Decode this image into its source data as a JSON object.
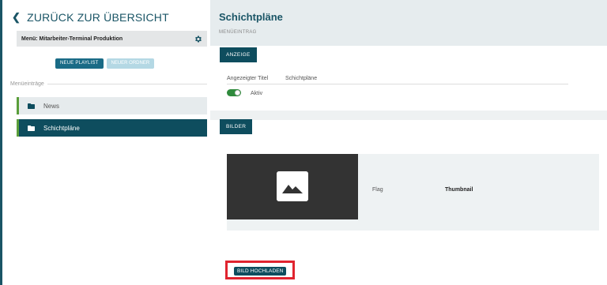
{
  "sidebar": {
    "back_link": "ZURÜCK ZUR ÜBERSICHT",
    "menu_label": "Menü: Mitarbeiter-Terminal Produktion",
    "btn_new_playlist": "NEUE PLAYLIST",
    "btn_new_folder": "NEUER ORDNER",
    "section_label": "Menüeinträge",
    "items": [
      {
        "label": "News",
        "icon": "folder-icon",
        "selected": false
      },
      {
        "label": "Schichtpläne",
        "icon": "folder-icon",
        "selected": true
      }
    ]
  },
  "main": {
    "title": "Schichtpläne",
    "subtitle": "MENÜEINTRAG",
    "tab_display": "ANZEIGE",
    "field_title_label": "Angezeigter Titel",
    "field_title_value": "Schichtpläne",
    "toggle_label": "Aktiv",
    "toggle_on": true,
    "tab_images": "BILDER",
    "image": {
      "flag_label": "Flag",
      "flag_value": "Thumbnail"
    },
    "upload_button": "BILD HOCHLADEN"
  },
  "colors": {
    "accent_dark": "#0e4d5e",
    "accent_button": "#1a6b86",
    "accent_disabled": "#b4d8e4",
    "toggle_green": "#2f8a3c",
    "highlight_red": "#e0242f"
  }
}
